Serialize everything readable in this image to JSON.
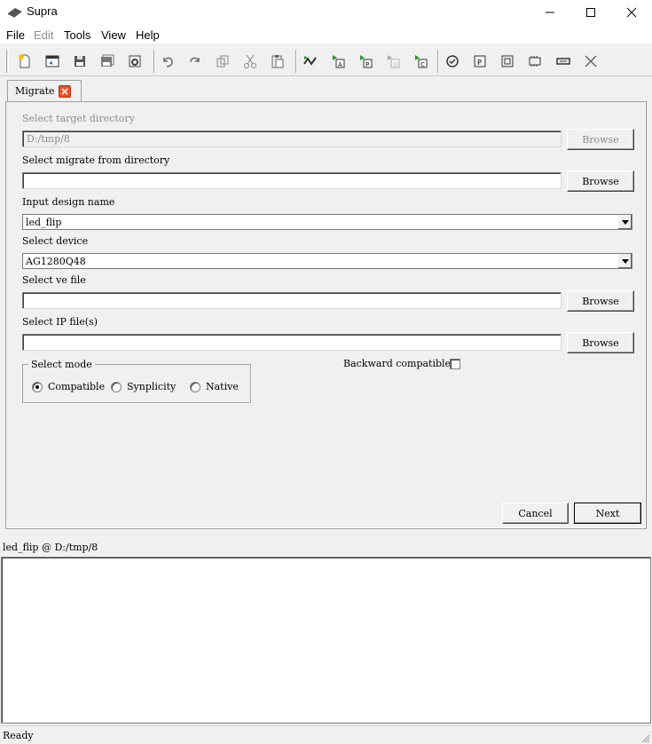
{
  "window": {
    "title": "Supra",
    "icon": "supra-app-icon",
    "controls": [
      "minimize-icon",
      "maximize-icon",
      "close-icon"
    ]
  },
  "menu": {
    "file": "File",
    "edit": "Edit",
    "tools": "Tools",
    "view": "View",
    "help": "Help"
  },
  "toolbar": {
    "buttons": [
      "new-project-icon",
      "open-project-icon",
      "save-icon",
      "save-as-icon",
      "project-settings-icon",
      "undo-icon",
      "redo-icon",
      "copy-icon",
      "cut-icon",
      "paste-icon",
      "run-flow-icon",
      "run-analysis-icon",
      "run-place-icon",
      "run-optimize-icon",
      "run-compile-icon",
      "check-icon",
      "program-icon",
      "device-icon",
      "chip-icon",
      "memory-icon",
      "stop-icon"
    ]
  },
  "tab": {
    "label": "Migrate",
    "close_icon": "tab-close-icon",
    "accent": "#e5552c"
  },
  "form": {
    "target_dir": {
      "label": "Select target directory",
      "value": "D:/tmp/8",
      "button": "Browse"
    },
    "migrate_from": {
      "label": "Select migrate from directory",
      "value": "",
      "button": "Browse"
    },
    "design_name": {
      "label": "Input design name",
      "value": "led_flip"
    },
    "device": {
      "label": "Select device",
      "value": "AG1280Q48"
    },
    "ve_file": {
      "label": "Select ve file",
      "value": "",
      "button": "Browse"
    },
    "ip_files": {
      "label": "Select IP file(s)",
      "value": "",
      "button": "Browse"
    },
    "mode": {
      "title": "Select mode",
      "options": [
        "Compatible",
        "Synplicity",
        "Native"
      ],
      "selected": "Compatible"
    },
    "backward_compatible": {
      "label": "Backward compatible",
      "checked": false
    },
    "cancel": "Cancel",
    "next": "Next"
  },
  "status": {
    "project": "led_flip @ D:/tmp/8",
    "ready": "Ready"
  }
}
